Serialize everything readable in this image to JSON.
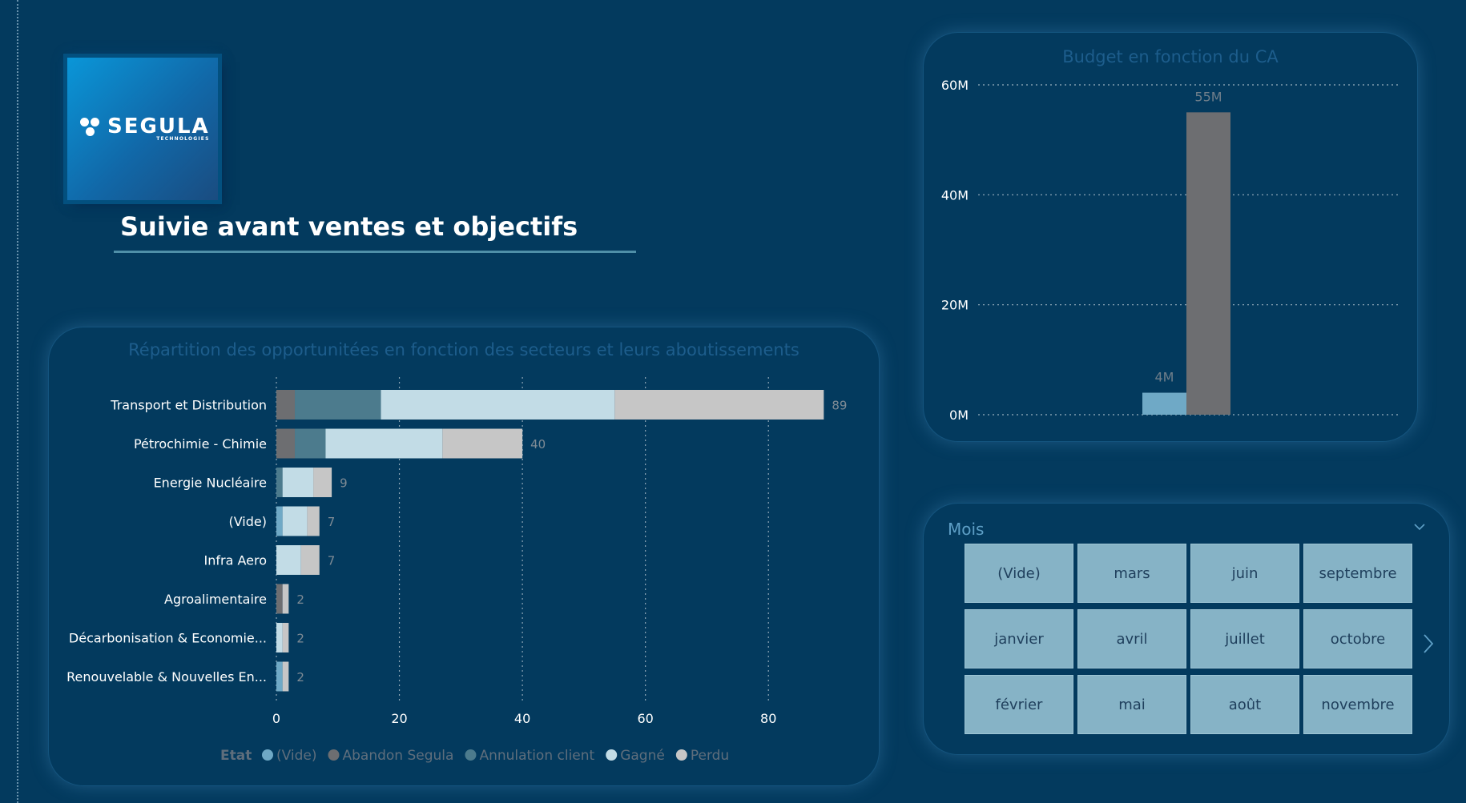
{
  "logo": {
    "word": "SEGULA",
    "sub": "TECHNOLOGIES"
  },
  "page": {
    "title": "Suivie avant ventes et objectifs"
  },
  "colors": {
    "background": "#033a5e",
    "vide": "#6fa9c6",
    "abandon": "#6d6e71",
    "annulation": "#4c7b8d",
    "gagne": "#c2dce6",
    "perdu": "#c6c6c6",
    "tile": "#86b3c6"
  },
  "sector_chart": {
    "title": "Répartition des opportunitées en fonction des secteurs et leurs aboutissements",
    "legend_title": "Etat"
  },
  "budget_chart": {
    "title": "Budget en fonction du CA"
  },
  "month_slicer": {
    "header": "Mois",
    "tiles": [
      "(Vide)",
      "mars",
      "juin",
      "septembre",
      "janvier",
      "avril",
      "juillet",
      "octobre",
      "février",
      "mai",
      "août",
      "novembre"
    ]
  },
  "chart_data": [
    {
      "type": "bar",
      "orientation": "horizontal",
      "stacked": true,
      "title": "Répartition des opportunitées en fonction des secteurs et leurs aboutissements",
      "categories": [
        "Transport et Distribution",
        "Pétrochimie - Chimie",
        "Energie Nucléaire",
        "(Vide)",
        "Infra Aero",
        "Agroalimentaire",
        "Décarbonisation & Economie...",
        "Renouvelable & Nouvelles En..."
      ],
      "series": [
        {
          "name": "(Vide)",
          "values": [
            0,
            0,
            0,
            1,
            0,
            0,
            0,
            1
          ]
        },
        {
          "name": "Abandon Segula",
          "values": [
            3,
            3,
            0,
            0,
            0,
            1,
            0,
            0
          ]
        },
        {
          "name": "Annulation client",
          "values": [
            14,
            5,
            1,
            0,
            0,
            0,
            0,
            0
          ]
        },
        {
          "name": "Gagné",
          "values": [
            38,
            19,
            5,
            4,
            4,
            0,
            1,
            0
          ]
        },
        {
          "name": "Perdu",
          "values": [
            34,
            13,
            3,
            2,
            3,
            1,
            1,
            1
          ]
        }
      ],
      "totals": [
        89,
        40,
        9,
        7,
        7,
        2,
        2,
        2
      ],
      "xlim": [
        0,
        90
      ],
      "xticks": [
        0,
        20,
        40,
        60,
        80
      ],
      "legend_title": "Etat",
      "legend_position": "bottom",
      "grid": true
    },
    {
      "type": "bar",
      "title": "Budget en fonction du CA",
      "series": [
        {
          "value": 4,
          "label": "4M"
        },
        {
          "value": 55,
          "label": "55M"
        }
      ],
      "ylim": [
        0,
        60
      ],
      "yticks": [
        0,
        20,
        40,
        60
      ],
      "ytick_labels": [
        "0M",
        "20M",
        "40M",
        "60M"
      ],
      "grid": true
    }
  ]
}
